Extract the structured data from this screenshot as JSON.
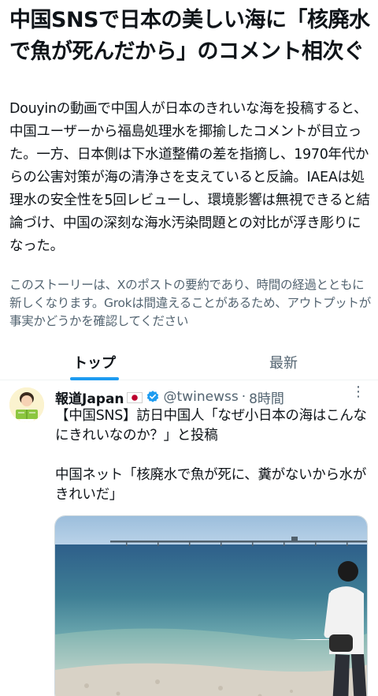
{
  "headline": "中国SNSで日本の美しい海に「核廃水で魚が死んだから」のコメント相次ぐ",
  "summary": "Douyinの動画で中国人が日本のきれいな海を投稿すると、中国ユーザーから福島処理水を揶揄したコメントが目立った。一方、日本側は下水道整備の差を指摘し、1970年代からの公害対策が海の清浄さを支えていると反論。IAEAは処理水の安全性を5回レビューし、環境影響は無視できると結論づけ、中国の深刻な海水汚染問題との対比が浮き彫りになった。",
  "disclaimer": "このストーリーは、Xのポストの要約であり、時間の経過とともに新しくなります。Grokは間違えることがあるため、アウトプットが事実かどうかを確認してください",
  "tabs": [
    {
      "label": "トップ",
      "active": true
    },
    {
      "label": "最新",
      "active": false
    }
  ],
  "post": {
    "author": "報道Japan",
    "handle": "@twinewss",
    "separator": "·",
    "time": "8時間",
    "more": "⋮",
    "text": "【中国SNS】訪日中国人「なぜ小日本の海はこんなにきれいなのか？」と投稿\n\n中国ネット「核廃水で魚が死に、糞がないから水がきれいだ」",
    "icons": {
      "avatar": "newsreader-avatar-icon",
      "flag": "japan-flag-icon",
      "verified": "verified-badge-icon",
      "media": "sea-photo"
    },
    "colors": {
      "verified": "#1d9bf0",
      "flag_red": "#bc002d"
    }
  }
}
